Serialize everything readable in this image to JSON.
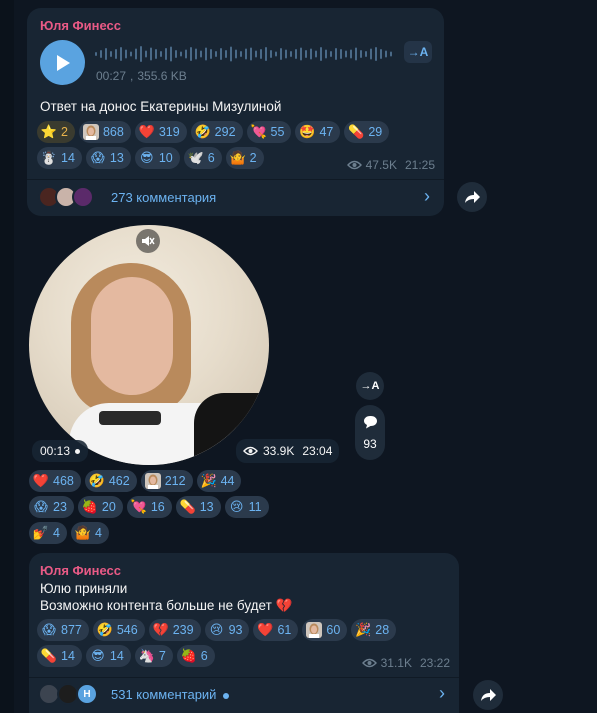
{
  "colors": {
    "bg": "#0e1621",
    "bubble": "#182533",
    "chip": "#2b3a4c",
    "accent": "#6cb3f1",
    "sender": "#e95a86"
  },
  "post1": {
    "sender": "Юля Финесс",
    "voice": {
      "duration": "00:27",
      "size": "355.6 KB",
      "transcribe_label": "→A"
    },
    "text": "Ответ на донос Екатерины Мизулиной",
    "reactions": [
      [
        {
          "icon": "star",
          "count": "2"
        },
        {
          "icon": "custom-avatar",
          "count": "868"
        },
        {
          "icon": "heart",
          "count": "319"
        },
        {
          "icon": "rofl",
          "count": "292"
        },
        {
          "icon": "heart-arrow",
          "count": "55"
        },
        {
          "icon": "starstruck",
          "count": "47"
        },
        {
          "icon": "pill",
          "count": "29"
        }
      ],
      [
        {
          "icon": "snowman",
          "count": "14"
        },
        {
          "icon": "scream",
          "count": "13"
        },
        {
          "icon": "sunglasses",
          "count": "10"
        },
        {
          "icon": "dove",
          "count": "6"
        },
        {
          "icon": "shrug",
          "count": "2"
        }
      ]
    ],
    "views": "47.5K",
    "time": "21:25",
    "comments": "273 комментария"
  },
  "post2": {
    "video_duration": "00:13",
    "views": "33.9K",
    "time": "23:04",
    "transcribe_label": "→A",
    "comment_count": "93",
    "reactions": [
      [
        {
          "icon": "heart",
          "count": "468"
        },
        {
          "icon": "rofl",
          "count": "462"
        },
        {
          "icon": "custom-avatar",
          "count": "212"
        },
        {
          "icon": "party",
          "count": "44"
        }
      ],
      [
        {
          "icon": "scream",
          "count": "23"
        },
        {
          "icon": "strawberry",
          "count": "20"
        },
        {
          "icon": "heart-arrow",
          "count": "16"
        },
        {
          "icon": "pill",
          "count": "13"
        },
        {
          "icon": "cry",
          "count": "11"
        }
      ],
      [
        {
          "icon": "nails",
          "count": "4"
        },
        {
          "icon": "shrug",
          "count": "4"
        }
      ]
    ]
  },
  "post3": {
    "sender": "Юля Финесс",
    "line1": "Юлю приняли",
    "line2": "Возможно контента больше не будет 💔",
    "reactions": [
      [
        {
          "icon": "scream",
          "count": "877"
        },
        {
          "icon": "rofl",
          "count": "546"
        },
        {
          "icon": "broken-heart",
          "count": "239"
        },
        {
          "icon": "cry",
          "count": "93"
        },
        {
          "icon": "heart",
          "count": "61"
        },
        {
          "icon": "custom-avatar",
          "count": "60"
        },
        {
          "icon": "party",
          "count": "28"
        }
      ],
      [
        {
          "icon": "pill",
          "count": "14"
        },
        {
          "icon": "sunglasses",
          "count": "14"
        },
        {
          "icon": "unicorn",
          "count": "7"
        },
        {
          "icon": "strawberry",
          "count": "6"
        }
      ]
    ],
    "views": "31.1K",
    "time": "23:22",
    "comments": "531 комментарий",
    "avatar_initial": "Н"
  }
}
